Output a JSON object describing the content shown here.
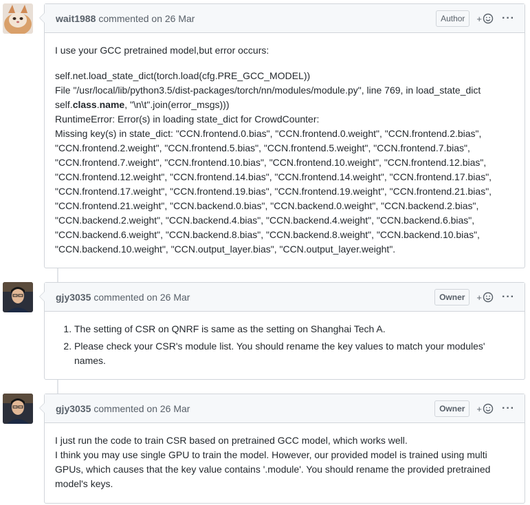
{
  "comments": [
    {
      "author": "wait1988",
      "meta": "commented on 26 Mar",
      "role": "Author",
      "reaction_label": "+",
      "more_label": "···",
      "p1": "I use your GCC pretrained model,but error occurs:",
      "lines": [
        "self.net.load_state_dict(torch.load(cfg.PRE_GCC_MODEL))",
        "File \"/usr/local/lib/python3.5/dist-packages/torch/nn/modules/module.py\", line 769, in load_state_dict",
        "RuntimeError: Error(s) in loading state_dict for CrowdCounter:",
        "Missing key(s) in state_dict: \"CCN.frontend.0.bias\", \"CCN.frontend.0.weight\", \"CCN.frontend.2.bias\",",
        "\"CCN.frontend.2.weight\", \"CCN.frontend.5.bias\", \"CCN.frontend.5.weight\", \"CCN.frontend.7.bias\",",
        "\"CCN.frontend.7.weight\", \"CCN.frontend.10.bias\", \"CCN.frontend.10.weight\", \"CCN.frontend.12.bias\",",
        "\"CCN.frontend.12.weight\", \"CCN.frontend.14.bias\", \"CCN.frontend.14.weight\", \"CCN.frontend.17.bias\",",
        "\"CCN.frontend.17.weight\", \"CCN.frontend.19.bias\", \"CCN.frontend.19.weight\", \"CCN.frontend.21.bias\",",
        "\"CCN.frontend.21.weight\", \"CCN.backend.0.bias\", \"CCN.backend.0.weight\", \"CCN.backend.2.bias\",",
        "\"CCN.backend.2.weight\", \"CCN.backend.4.bias\", \"CCN.backend.4.weight\", \"CCN.backend.6.bias\",",
        "\"CCN.backend.6.weight\", \"CCN.backend.8.bias\", \"CCN.backend.8.weight\", \"CCN.backend.10.bias\",",
        "\"CCN.backend.10.weight\", \"CCN.output_layer.bias\", \"CCN.output_layer.weight\"."
      ],
      "class_line": {
        "pre": "self.",
        "bold1": "class",
        "dot": ".",
        "bold2": "name",
        "post": ", \"\\n\\t\".join(error_msgs)))"
      }
    },
    {
      "author": "gjy3035",
      "meta": "commented on 26 Mar",
      "role": "Owner",
      "reaction_label": "+",
      "more_label": "···",
      "items": [
        "The setting of CSR on QNRF is same as the setting on Shanghai Tech A.",
        "Please check your CSR's module list. You should rename the key values to match your modules' names."
      ]
    },
    {
      "author": "gjy3035",
      "meta": "commented on 26 Mar",
      "role": "Owner",
      "reaction_label": "+",
      "more_label": "···",
      "lines": [
        "I just run the code to train CSR based on pretrained GCC model, which works well.",
        "I think you may use single GPU to train the model. However, our provided model is trained using multi GPUs, which causes that the key value contains '.module'. You should rename the provided pretrained model's keys."
      ]
    }
  ],
  "colors": {
    "border": "#d1d5da",
    "header_bg": "#f6f8fa",
    "muted_text": "#586069",
    "body_text": "#24292e"
  },
  "icons": {
    "reaction": "smiley-icon",
    "more": "kebab-horizontal-icon"
  }
}
